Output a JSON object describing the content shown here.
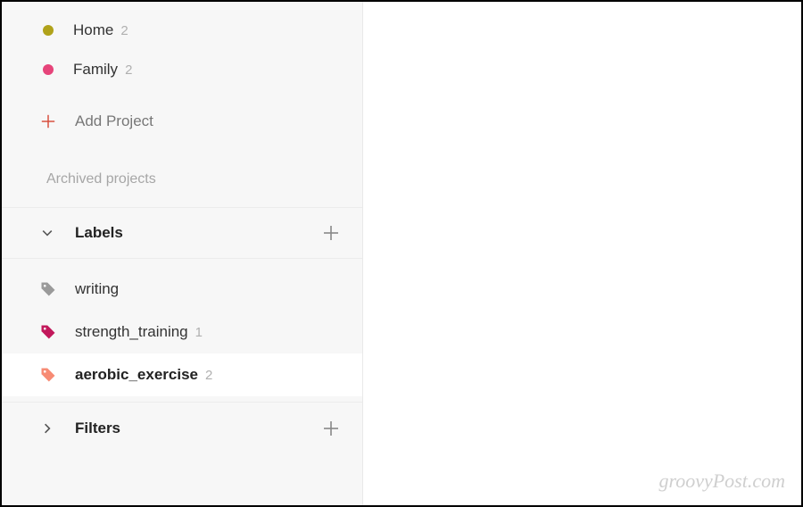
{
  "projects": [
    {
      "name": "Home",
      "count": "2",
      "color": "olive"
    },
    {
      "name": "Family",
      "count": "2",
      "color": "pink"
    }
  ],
  "add_project_label": "Add Project",
  "archived_label": "Archived projects",
  "sections": {
    "labels_title": "Labels",
    "filters_title": "Filters"
  },
  "labels": [
    {
      "name": "writing",
      "count": "",
      "color": "#9a9a9a",
      "selected": false
    },
    {
      "name": "strength_training",
      "count": "1",
      "color": "#c2185b",
      "selected": false
    },
    {
      "name": "aerobic_exercise",
      "count": "2",
      "color": "#f78b74",
      "selected": true
    }
  ],
  "watermark": "groovyPost.com"
}
